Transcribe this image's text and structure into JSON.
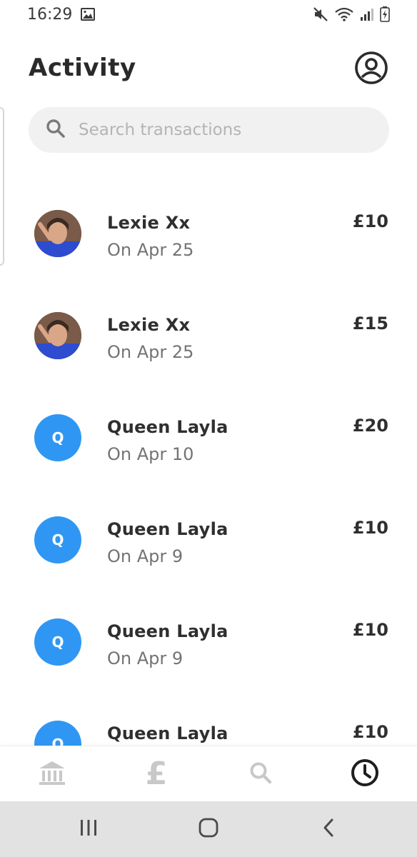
{
  "status_bar": {
    "time": "16:29",
    "icons": [
      "gallery-icon",
      "mute-icon",
      "wifi-icon",
      "signal-icon",
      "battery-charging-icon"
    ]
  },
  "header": {
    "title": "Activity",
    "profile_icon": "profile-icon"
  },
  "search": {
    "placeholder": "Search transactions",
    "value": ""
  },
  "transactions": [
    {
      "name": "Lexie Xx",
      "date": "On Apr 25",
      "amount": "£10",
      "avatar": "photo"
    },
    {
      "name": "Lexie Xx",
      "date": "On Apr 25",
      "amount": "£15",
      "avatar": "photo"
    },
    {
      "name": "Queen Layla",
      "date": "On Apr 10",
      "amount": "£20",
      "avatar": "letter",
      "initial": "Q"
    },
    {
      "name": "Queen Layla",
      "date": "On Apr 9",
      "amount": "£10",
      "avatar": "letter",
      "initial": "Q"
    },
    {
      "name": "Queen Layla",
      "date": "On Apr 9",
      "amount": "£10",
      "avatar": "letter",
      "initial": "Q"
    },
    {
      "name": "Queen Layla",
      "date": "",
      "amount": "£10",
      "avatar": "letter",
      "initial": "Q"
    }
  ],
  "bottom_nav": {
    "items": [
      "bank-icon",
      "pound-icon",
      "search-icon",
      "activity-clock-icon"
    ],
    "pound_glyph": "£",
    "active": "activity-clock-icon"
  },
  "system_nav": {
    "items": [
      "recents-icon",
      "home-icon",
      "back-icon"
    ]
  },
  "colors": {
    "accent": "#2f97f3",
    "text": "#2f2f2f",
    "muted": "#737373",
    "search_bg": "#f1f1f1",
    "system_nav_bg": "#e2e2e2"
  }
}
